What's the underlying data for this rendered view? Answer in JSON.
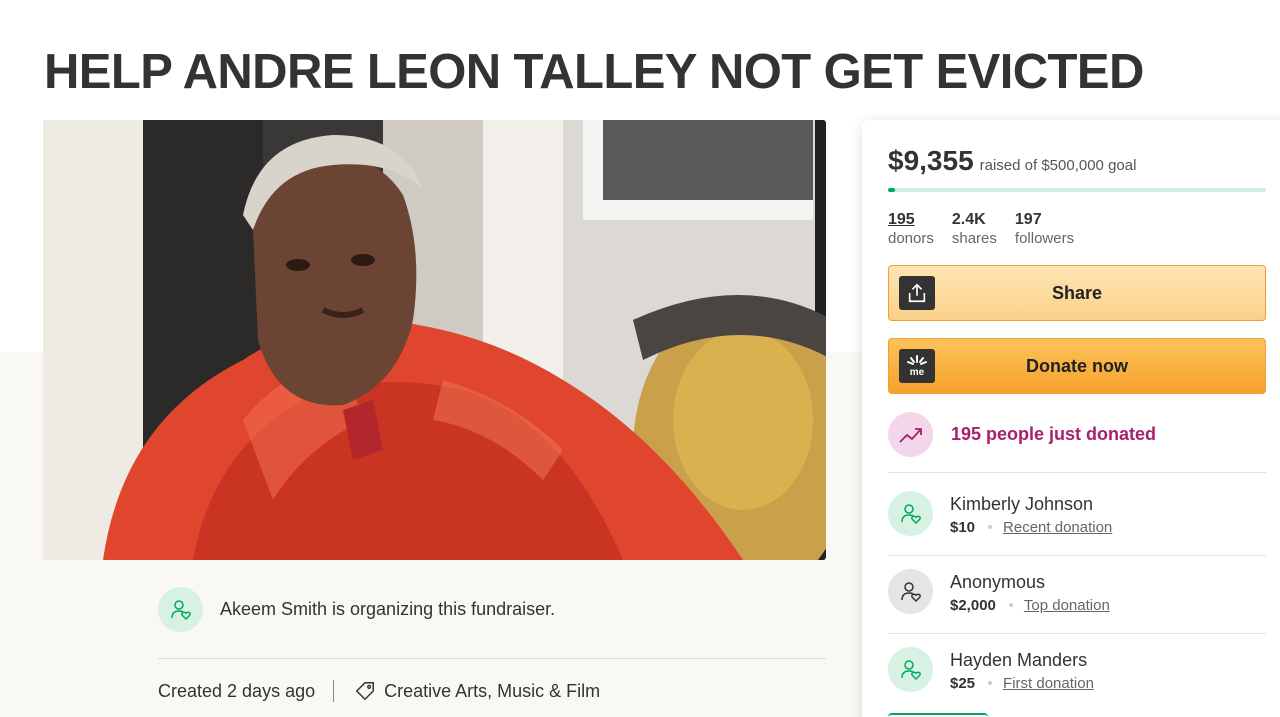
{
  "campaign": {
    "title": "HELP ANDRE LEON TALLEY NOT GET EVICTED"
  },
  "organizer": {
    "text": "Akeem Smith is organizing this fundraiser."
  },
  "meta": {
    "created": "Created 2 days ago",
    "category": "Creative Arts, Music & Film"
  },
  "progress": {
    "raised": "$9,355",
    "goal_text": "raised of $500,000 goal",
    "fraction": 0.0187
  },
  "stats": [
    {
      "value": "195",
      "label": "donors"
    },
    {
      "value": "2.4K",
      "label": "shares"
    },
    {
      "value": "197",
      "label": "followers"
    }
  ],
  "buttons": {
    "share": "Share",
    "donate": "Donate now"
  },
  "activity": {
    "just_donated": "195 people just donated"
  },
  "donations": [
    {
      "name": "Kimberly Johnson",
      "amount": "$10",
      "kind": "Recent donation",
      "avatar": "green"
    },
    {
      "name": "Anonymous",
      "amount": "$2,000",
      "kind": "Top donation",
      "avatar": "grey"
    },
    {
      "name": "Hayden Manders",
      "amount": "$25",
      "kind": "First donation",
      "avatar": "green"
    }
  ],
  "colors": {
    "brand_green": "#02a95c",
    "donate_orange": "#f6a12c",
    "share_yellow": "#fbd189",
    "activity_magenta": "#a81f6e"
  },
  "icons": {
    "share": "upload-share-icon",
    "donate": "gofundme-logo-icon",
    "trending": "trending-up-icon",
    "user": "user-heart-icon",
    "tag": "tag-icon"
  }
}
